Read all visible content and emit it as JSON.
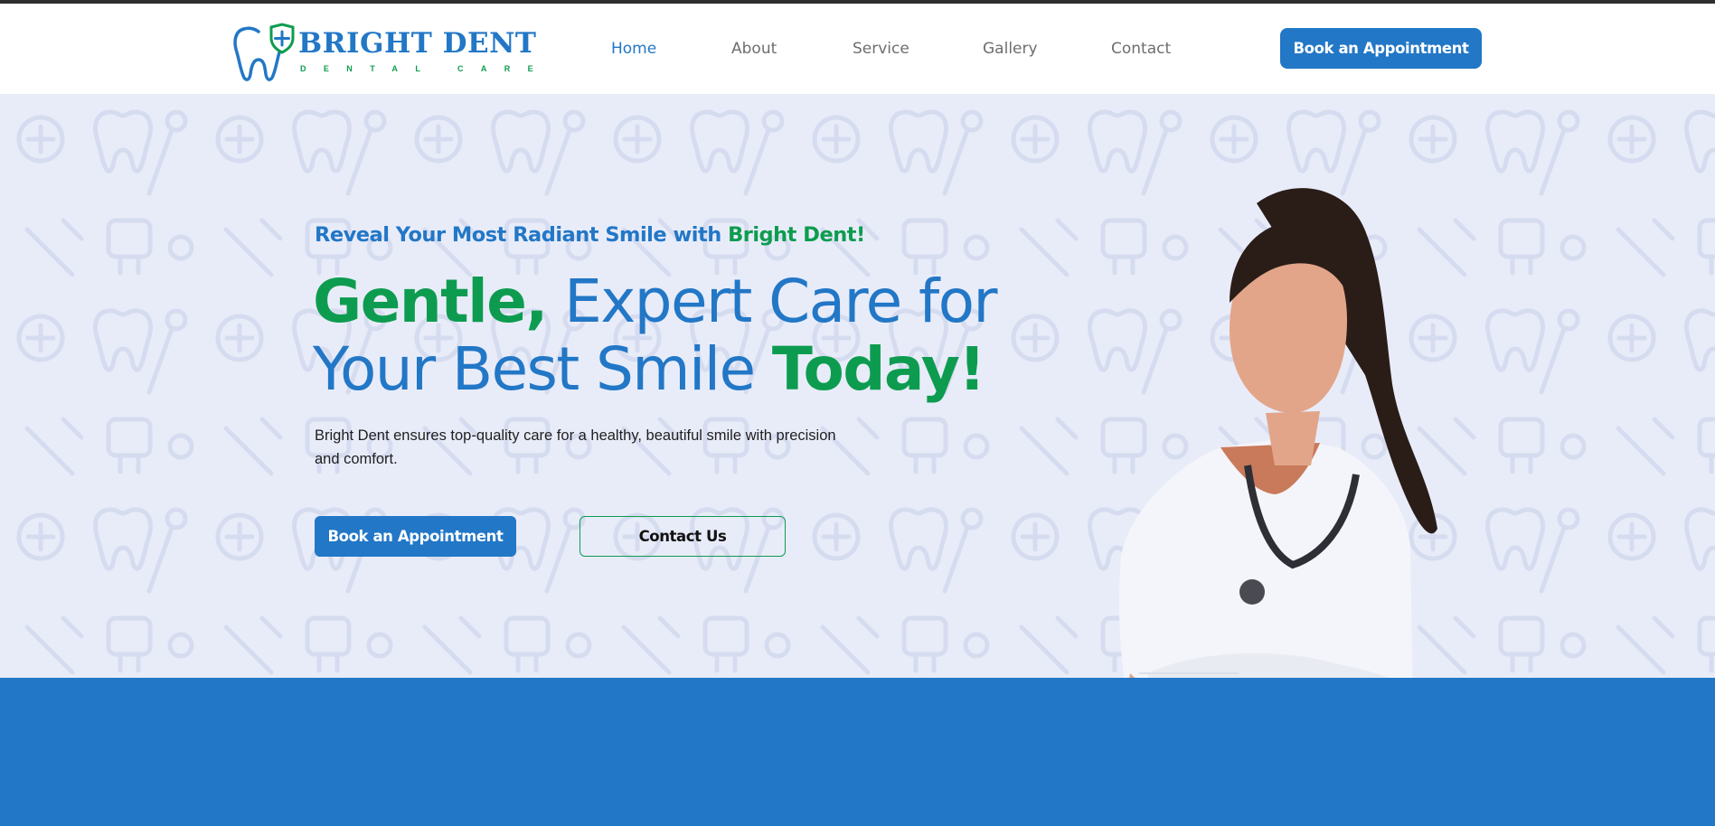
{
  "brand": {
    "name": "BRIGHT DENT",
    "subtitle": "DENTAL CARE",
    "colors": {
      "primary": "#2277c6",
      "accent": "#0d9c4f",
      "hero_bg": "#e8ecf9"
    }
  },
  "nav": {
    "items": [
      {
        "label": "Home",
        "active": true
      },
      {
        "label": "About",
        "active": false
      },
      {
        "label": "Service",
        "active": false
      },
      {
        "label": "Gallery",
        "active": false
      },
      {
        "label": "Contact",
        "active": false
      }
    ],
    "cta_label": "Book an Appointment"
  },
  "hero": {
    "tagline_part1": "Reveal Your Most Radiant Smile with ",
    "tagline_part2": "Bright Dent!",
    "headline_1a": "Gentle,",
    "headline_1b": " Expert Care for",
    "headline_2a": "Your Best Smile ",
    "headline_2b": "Today!",
    "description": "Bright Dent ensures top-quality care for a healthy, beautiful smile with precision and comfort.",
    "primary_button": "Book an Appointment",
    "secondary_button": "Contact Us",
    "image": "doctor-photo"
  }
}
